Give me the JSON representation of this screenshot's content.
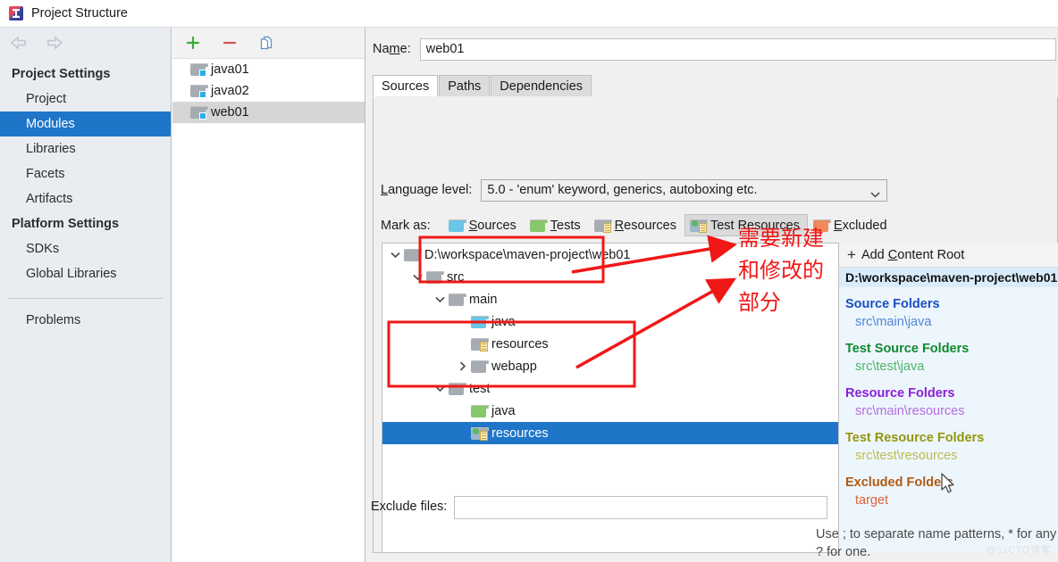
{
  "window": {
    "title": "Project Structure",
    "icon": "intellij-idea-icon"
  },
  "sidebar": {
    "back_icon": "arrow-left-icon",
    "forward_icon": "arrow-right-icon",
    "groups": [
      {
        "label": "Project Settings"
      },
      {
        "label": "Platform Settings"
      }
    ],
    "items": [
      {
        "label": "Project",
        "selected": false
      },
      {
        "label": "Modules",
        "selected": true
      },
      {
        "label": "Libraries",
        "selected": false
      },
      {
        "label": "Facets",
        "selected": false
      },
      {
        "label": "Artifacts",
        "selected": false
      },
      {
        "label": "SDKs",
        "selected": false
      },
      {
        "label": "Global Libraries",
        "selected": false
      },
      {
        "label": "Problems",
        "selected": false
      }
    ]
  },
  "modules": {
    "toolbar": {
      "add_icon": "plus-icon",
      "remove_icon": "minus-icon",
      "copy_icon": "copy-icon"
    },
    "list": [
      {
        "label": "java01",
        "selected": false
      },
      {
        "label": "java02",
        "selected": false
      },
      {
        "label": "web01",
        "selected": true
      }
    ]
  },
  "detail": {
    "name_label": "Name:",
    "name_value": "web01",
    "tabs": [
      {
        "label": "Sources",
        "active": true
      },
      {
        "label": "Paths",
        "active": false
      },
      {
        "label": "Dependencies",
        "active": false
      }
    ],
    "language_level_label": "Language level:",
    "language_level_value": "5.0 - 'enum' keyword, generics, autoboxing etc.",
    "language_level_chevron": "chevron-down-icon",
    "mark_as_label": "Mark as:",
    "mark_as_buttons": [
      {
        "label": "Sources",
        "mnemonic": "S",
        "icon": "folder-blue-icon",
        "pressed": false
      },
      {
        "label": "Tests",
        "mnemonic": "T",
        "icon": "folder-green-icon",
        "pressed": false
      },
      {
        "label": "Resources",
        "mnemonic": "R",
        "icon": "folder-gray-resource-icon",
        "pressed": false
      },
      {
        "label": "Test Resources",
        "mnemonic": "T",
        "icon": "folder-test-resource-icon",
        "pressed": true
      },
      {
        "label": "Excluded",
        "mnemonic": "E",
        "icon": "folder-orange-icon",
        "pressed": false
      }
    ],
    "tree": [
      {
        "label": "D:\\workspace\\maven-project\\web01",
        "depth": 0,
        "twisty": "expanded",
        "icon": "folder-gray-icon",
        "selected": false
      },
      {
        "label": "src",
        "depth": 1,
        "twisty": "expanded",
        "icon": "folder-gray-icon",
        "selected": false
      },
      {
        "label": "main",
        "depth": 2,
        "twisty": "expanded",
        "icon": "folder-gray-icon",
        "selected": false
      },
      {
        "label": "java",
        "depth": 3,
        "twisty": "none",
        "icon": "folder-blue-icon",
        "selected": false
      },
      {
        "label": "resources",
        "depth": 3,
        "twisty": "none",
        "icon": "folder-gray-resource-icon",
        "selected": false
      },
      {
        "label": "webapp",
        "depth": 2,
        "twisty": "collapsed",
        "icon": "folder-gray-icon",
        "selected": false
      },
      {
        "label": "test",
        "depth": 2,
        "twisty": "expanded",
        "icon": "folder-gray-icon",
        "selected": false
      },
      {
        "label": "java",
        "depth": 3,
        "twisty": "none",
        "icon": "folder-green-icon",
        "selected": false
      },
      {
        "label": "resources",
        "depth": 3,
        "twisty": "none",
        "icon": "folder-test-resource-icon",
        "selected": true
      }
    ],
    "content_root": {
      "add_label": "Add Content Root",
      "add_mnemonic": "C",
      "add_icon": "plus-icon",
      "path": "D:\\workspace\\maven-project\\web01",
      "groups": [
        {
          "title": "Source Folders",
          "color": "#1a4fbf",
          "item_color": "#4f86d6",
          "items": [
            "src\\main\\java"
          ]
        },
        {
          "title": "Test Source Folders",
          "color": "#108a2e",
          "item_color": "#4cb36a",
          "items": [
            "src\\test\\java"
          ]
        },
        {
          "title": "Resource Folders",
          "color": "#8a1fd6",
          "item_color": "#b36be0",
          "items": [
            "src\\main\\resources"
          ]
        },
        {
          "title": "Test Resource Folders",
          "color": "#93960d",
          "item_color": "#b9bc52",
          "items": [
            "src\\test\\resources"
          ]
        },
        {
          "title": "Excluded Folders",
          "color": "#b05a12",
          "item_color": "#e0603a",
          "items": [
            "target"
          ]
        }
      ]
    },
    "exclude_label": "Exclude files:",
    "exclude_value": "",
    "exclude_hint_line1": "Use ; to separate name patterns, * for any number of symbols,",
    "exclude_hint_line2": "? for one."
  },
  "annotations": {
    "color": "#f01717",
    "lines": [
      "需要新建",
      "和修改的",
      "部分"
    ]
  },
  "watermark": "@51CTO博客",
  "cursor": "mouse-pointer-icon"
}
